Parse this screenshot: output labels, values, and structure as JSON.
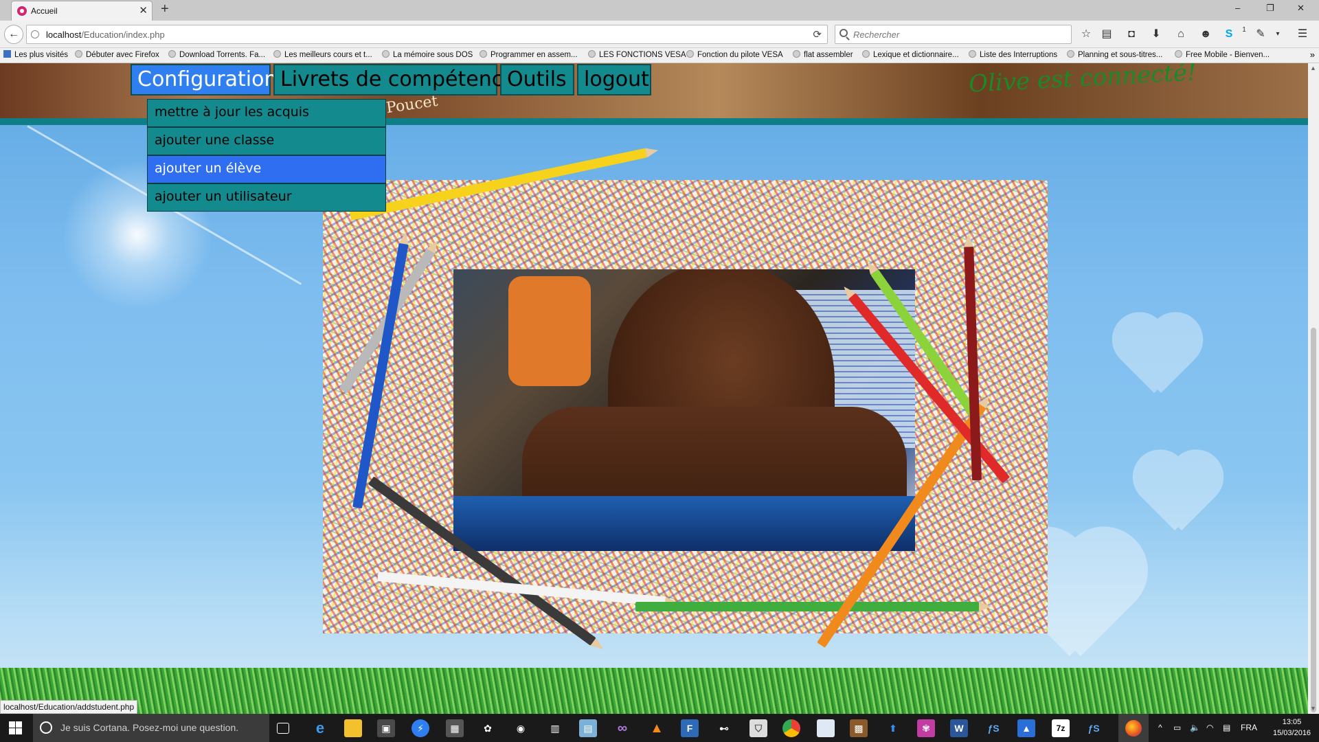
{
  "browser": {
    "tab_title": "Accueil",
    "tab_close": "✕",
    "new_tab": "+",
    "url_host": "localhost",
    "url_path": "/Education/index.php",
    "search_placeholder": "Rechercher",
    "window_controls": [
      "–",
      "❐",
      "✕"
    ],
    "notification_badge": "1"
  },
  "bookmarks": [
    "Les plus visités",
    "Débuter avec Firefox",
    "Download Torrents. Fa...",
    "Les meilleurs cours et t...",
    "La mémoire sous DOS",
    "Programmer en assem...",
    "LES FONCTIONS VESA",
    "Fonction du pilote VESA",
    "flat assembler",
    "Lexique et dictionnaire...",
    "Liste des Interruptions",
    "Planning et sous-titres...",
    "Free Mobile - Bienven..."
  ],
  "site": {
    "menu": [
      "Configuration",
      "Livrets de compétence",
      "Outils",
      "logout"
    ],
    "active_menu_index": 0,
    "dropdown": [
      "mettre à jour les acquis",
      "ajouter une classe",
      "ajouter un élève",
      "ajouter un utilisateur"
    ],
    "hovered_dropdown_index": 2,
    "welcome": "Olive est connecté!",
    "banner_caption": "Poucet"
  },
  "status_url": "localhost/Education/addstudent.php",
  "taskbar": {
    "cortana_placeholder": "Je suis Cortana. Posez-moi une question.",
    "language": "FRA",
    "time": "13:05",
    "date": "15/03/2016"
  }
}
